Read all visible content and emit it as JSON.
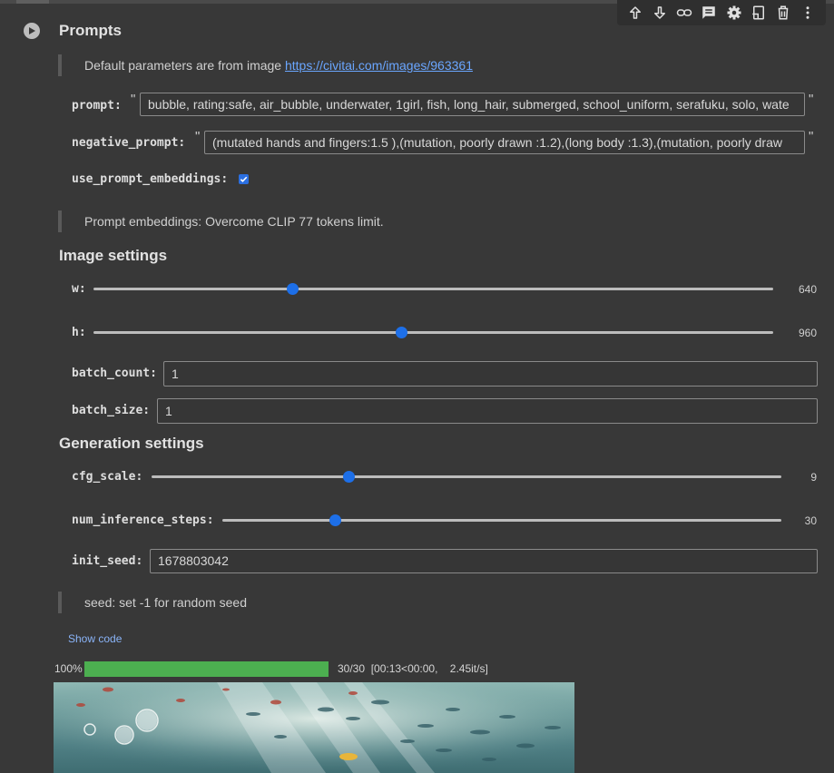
{
  "toolbar": {
    "icons": [
      "arrow-up-icon",
      "arrow-down-icon",
      "link-icon",
      "comment-icon",
      "gear-icon",
      "mirror-cell-icon",
      "trash-icon",
      "more-vert-icon"
    ]
  },
  "section_prompts": {
    "title": "Prompts",
    "note_prefix": "Default parameters are from image ",
    "note_link": "https://civitai.com/images/963361",
    "prompt_label": "prompt:",
    "prompt_value": "bubble, rating:safe, air_bubble, underwater, 1girl, fish, long_hair, submerged, school_uniform, serafuku, solo, wate",
    "negative_label": "negative_prompt:",
    "negative_value": "(mutated hands and fingers:1.5 ),(mutation, poorly drawn :1.2),(long body :1.3),(mutation, poorly draw",
    "quote_mark": "\"",
    "embeddings_label": "use_prompt_embeddings:",
    "embeddings_checked": true,
    "embeddings_note": "Prompt embeddings: Overcome CLIP 77 tokens limit."
  },
  "section_image": {
    "title": "Image settings",
    "w_label": "w:",
    "w_value": 640,
    "w_value_text": "640",
    "w_fraction": 0.293,
    "h_label": "h:",
    "h_value": 960,
    "h_value_text": "960",
    "h_fraction": 0.452,
    "batch_count_label": "batch_count:",
    "batch_count_value": "1",
    "batch_size_label": "batch_size:",
    "batch_size_value": "1"
  },
  "section_generation": {
    "title": "Generation settings",
    "cfg_label": "cfg_scale:",
    "cfg_value": 9,
    "cfg_value_text": "9",
    "cfg_fraction": 0.312,
    "steps_label": "num_inference_steps:",
    "steps_value": 30,
    "steps_value_text": "30",
    "steps_fraction": 0.202,
    "seed_label": "init_seed:",
    "seed_value": "1678803042",
    "seed_note": "seed: set -1 for random seed"
  },
  "output": {
    "show_code": "Show code",
    "progress_percent_text": "100%",
    "progress_fraction": 1.0,
    "progress_info": "30/30  [00:13<00:00,    2.45it/s]"
  },
  "colors": {
    "background": "#383838",
    "accent": "#1d6fe8",
    "link": "#6aa6ff",
    "progress": "#4caf50"
  }
}
